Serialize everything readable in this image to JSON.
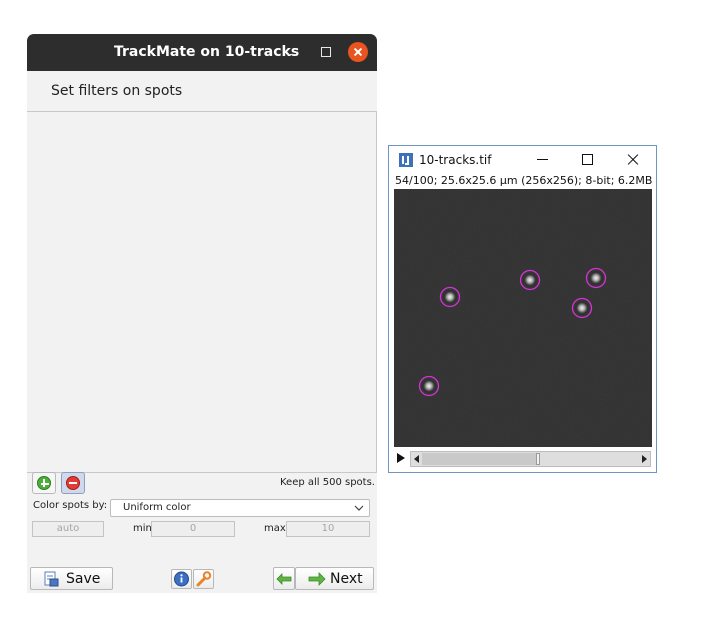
{
  "trackmate": {
    "title": "TrackMate on 10-tracks",
    "heading": "Set filters on spots",
    "keep_text": "Keep all 500 spots.",
    "color_by_label": "Color spots by:",
    "color_by_value": "Uniform color",
    "auto_label": "auto",
    "min_label": "min",
    "min_value": "0",
    "max_label": "max",
    "max_value": "10",
    "save_label": "Save",
    "next_label": "Next"
  },
  "image_window": {
    "title": "10-tracks.tif",
    "info": "54/100; 25.6x25.6 µm (256x256); 8-bit; 6.2MB",
    "frame": 54,
    "frame_count": 100,
    "spot_color": "#d633d6"
  },
  "colors": {
    "titlebar_dark": "#2d2d2d",
    "close_orange": "#e95420",
    "window_bg": "#f2f2f2",
    "image_window_border": "#6f95c4"
  }
}
